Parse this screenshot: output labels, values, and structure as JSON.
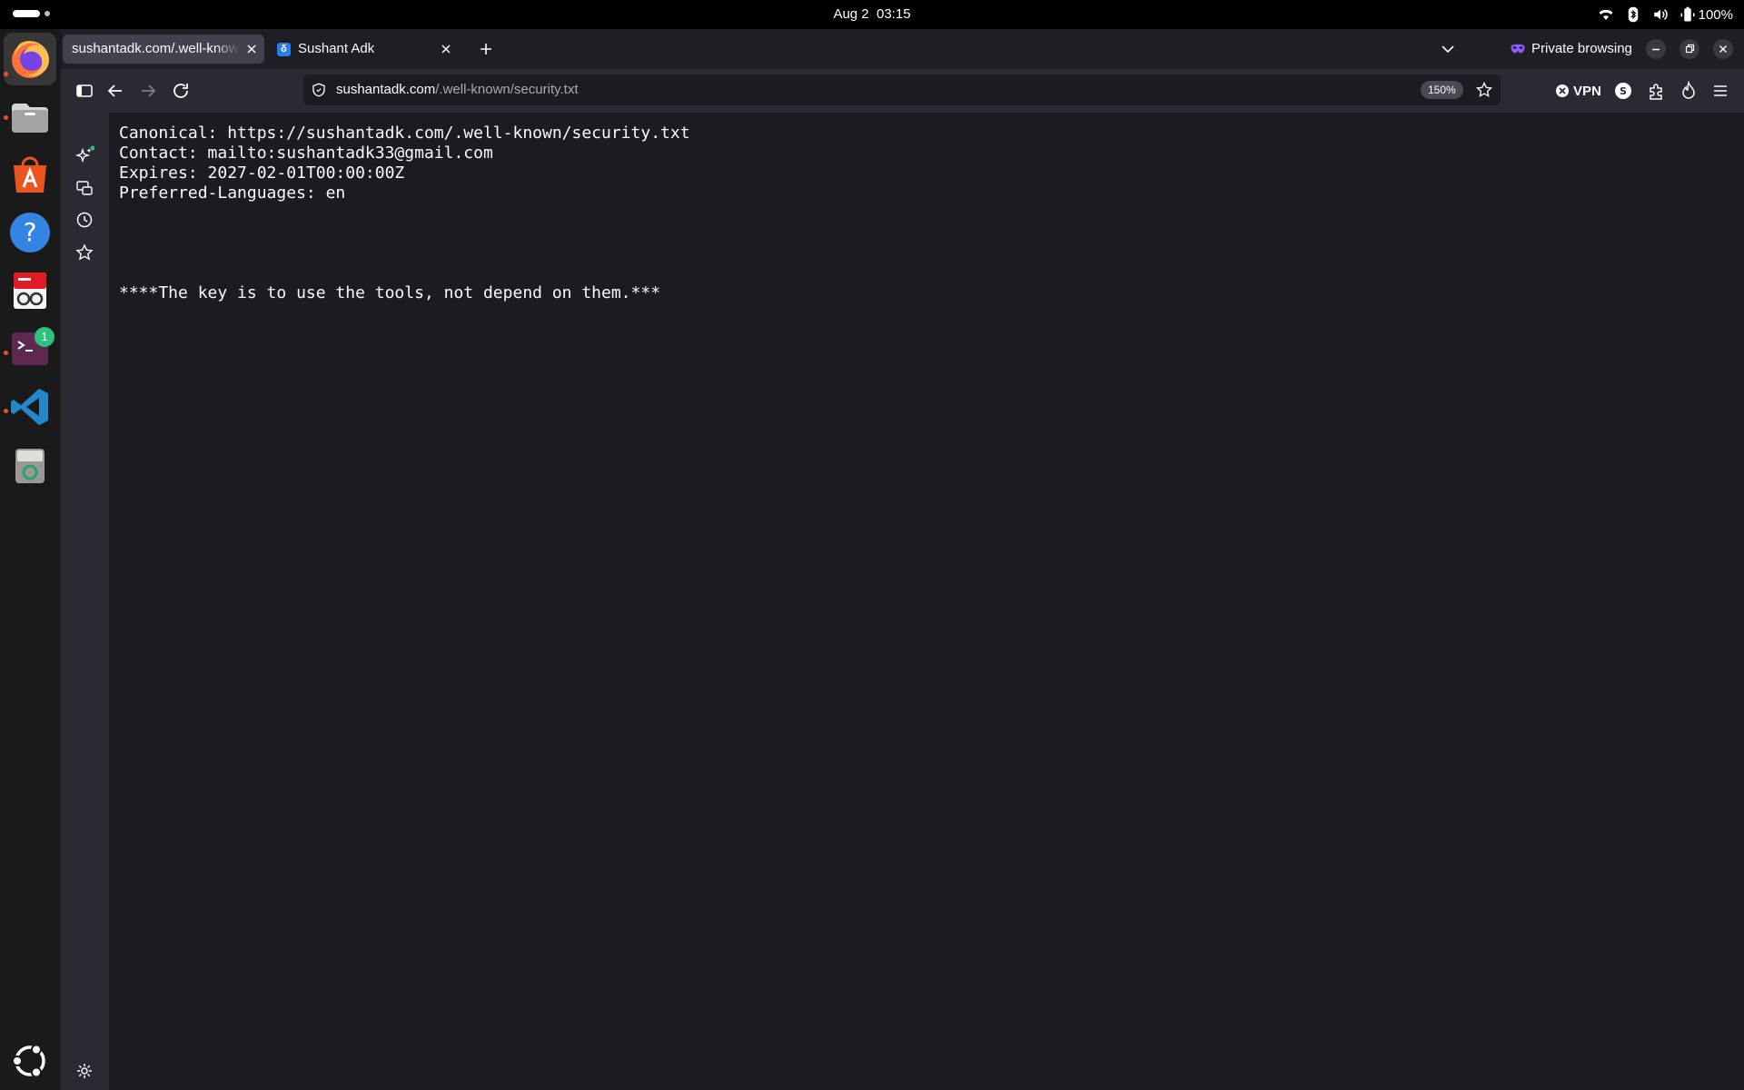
{
  "topbar": {
    "date": "Aug 2",
    "time": "03:15",
    "battery": "100%",
    "icons": [
      "wifi-icon",
      "bluetooth-icon",
      "volume-icon",
      "battery-icon"
    ]
  },
  "dock": {
    "apps": [
      "firefox",
      "files",
      "app-center",
      "help",
      "document-viewer",
      "terminal",
      "vs-code",
      "trash"
    ],
    "terminal_badge": "1"
  },
  "browser": {
    "tabs": [
      {
        "title": "sushantadk.com/.well-known/security.txt"
      },
      {
        "title": "Sushant Adk",
        "favicon": "δ"
      }
    ],
    "private_label": "Private browsing",
    "url_domain": "sushantadk.com",
    "url_path": "/.well-known/security.txt",
    "zoom": "150%",
    "vpn_label": "VPN"
  },
  "content": {
    "lines": [
      "Canonical: https://sushantadk.com/.well-known/security.txt",
      "Contact: mailto:sushantadk33@gmail.com",
      "Expires: 2027-02-01T00:00:00Z",
      "Preferred-Languages: en",
      "",
      "",
      "",
      "",
      "****The key is to use the tools, not depend on them.***"
    ]
  },
  "colors": {
    "page_bg": "#1c1b22",
    "toolbar_bg": "#2b2a33",
    "accent_orange": "#e95420",
    "badge_green": "#2ec27e"
  }
}
